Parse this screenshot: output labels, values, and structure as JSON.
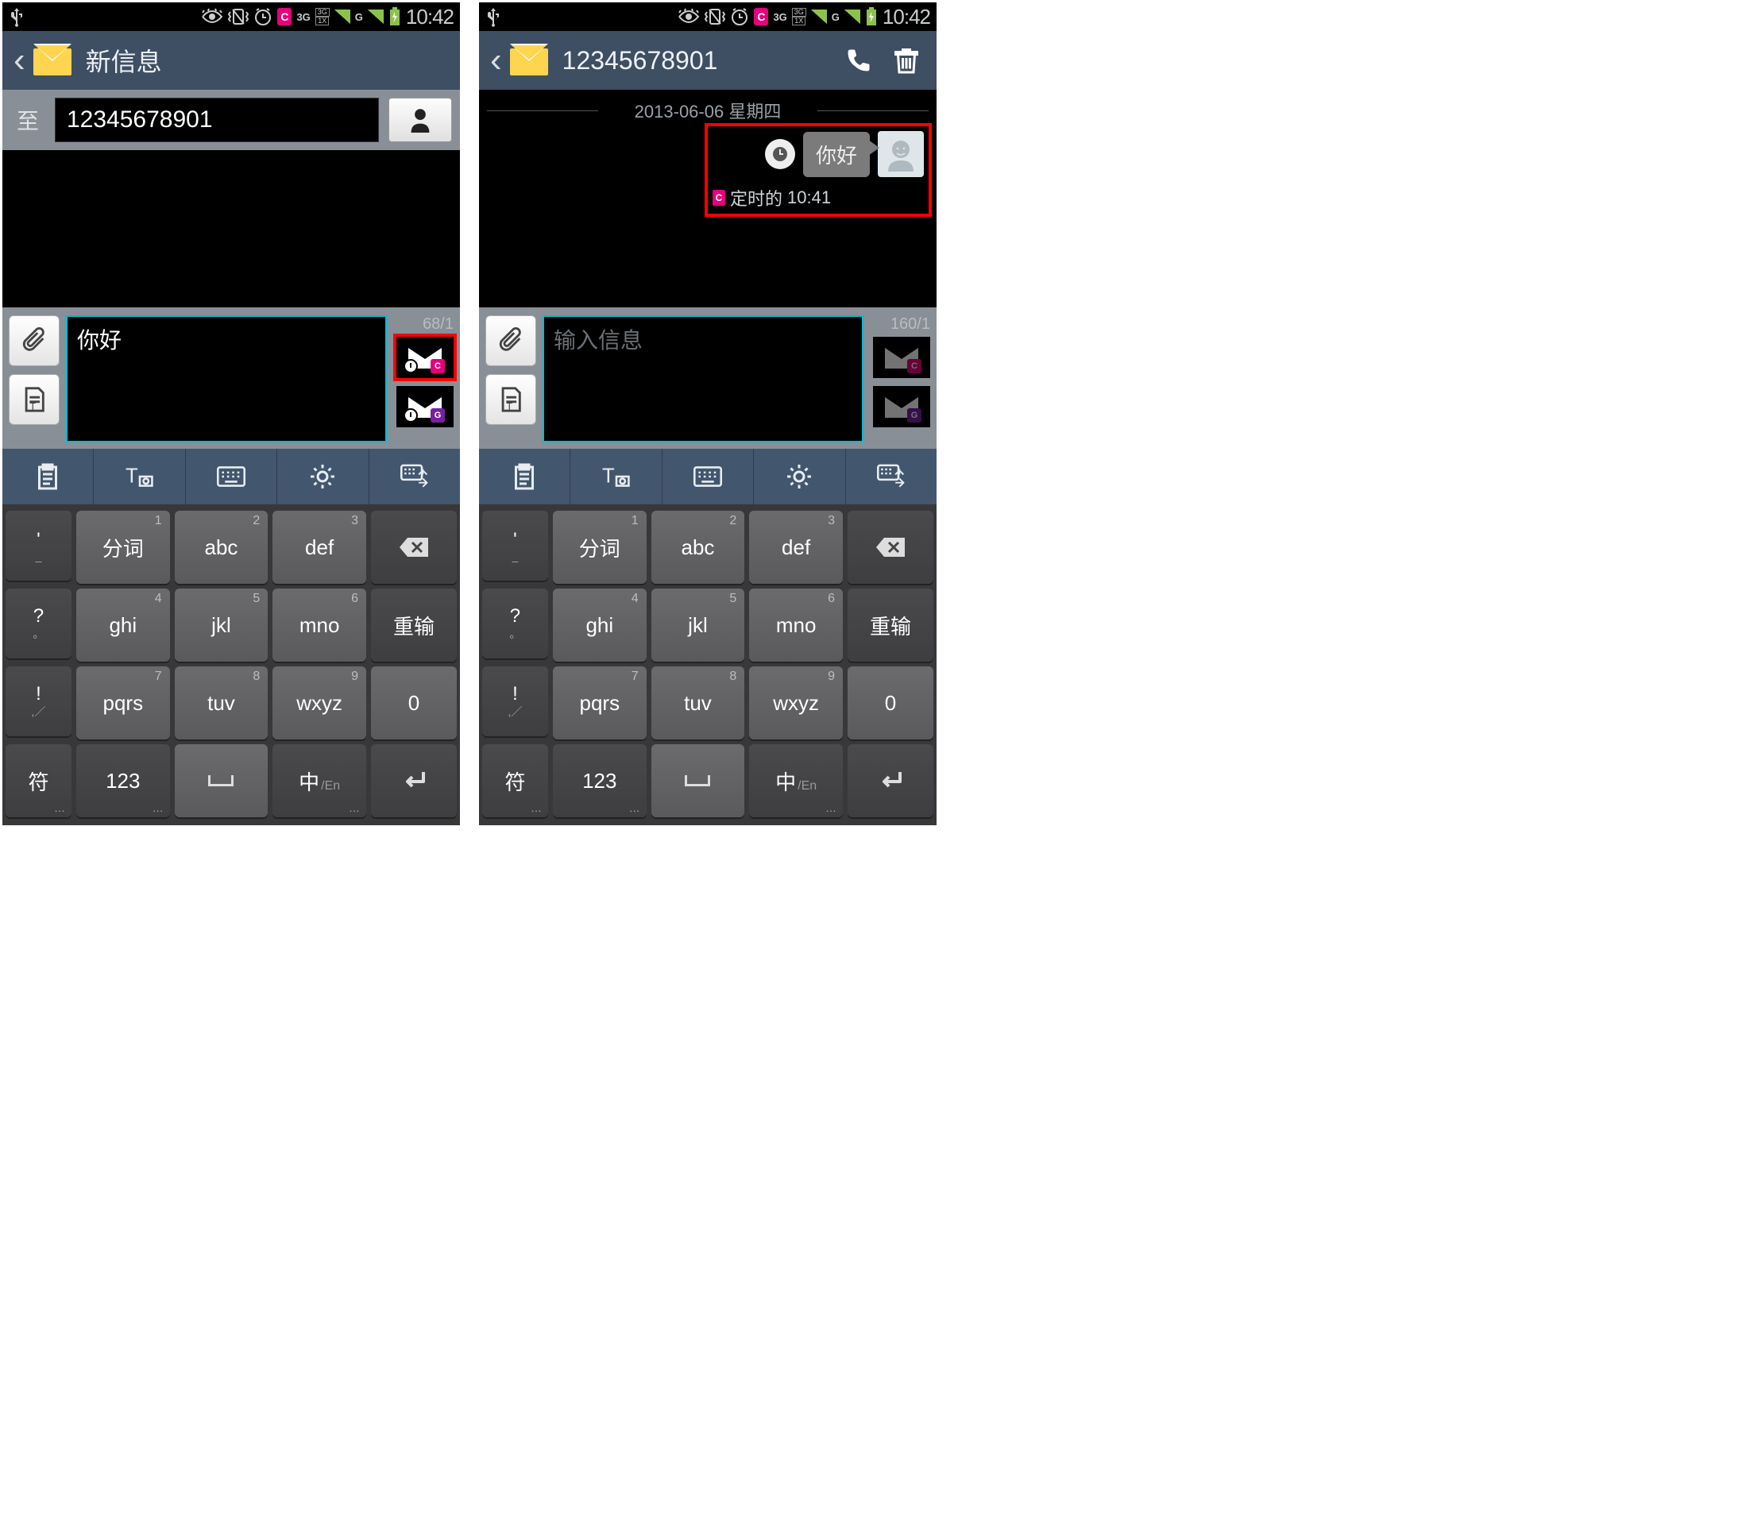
{
  "status": {
    "time": "10:42",
    "net1": "3G",
    "net2a": "3G",
    "net2b": "1X",
    "g": "G",
    "sim": "C"
  },
  "left": {
    "title": "新信息",
    "recipient_label": "至",
    "recipient_value": "12345678901",
    "compose_value": "你好",
    "counter": "68/1"
  },
  "right": {
    "title": "12345678901",
    "date_sep": "2013-06-06 星期四",
    "bubble_text": "你好",
    "scheduled_label": "定时的",
    "scheduled_time": "10:41",
    "compose_placeholder": "输入信息",
    "counter": "160/1"
  },
  "send_tags": {
    "c": "C",
    "g": "G"
  },
  "keyboard": {
    "punct": [
      "'",
      "?",
      "!"
    ],
    "punct_sub": [
      "_",
      "。",
      ",／"
    ],
    "r1": [
      {
        "main": "分词",
        "num": "1"
      },
      {
        "main": "abc",
        "num": "2"
      },
      {
        "main": "def",
        "num": "3"
      }
    ],
    "r2": [
      {
        "main": "ghi",
        "num": "4"
      },
      {
        "main": "jkl",
        "num": "5"
      },
      {
        "main": "mno",
        "num": "6"
      }
    ],
    "r3": [
      {
        "main": "pqrs",
        "num": "7"
      },
      {
        "main": "tuv",
        "num": "8"
      },
      {
        "main": "wxyz",
        "num": "9"
      }
    ],
    "retype": "重输",
    "zero": "0",
    "sym": "符",
    "num_mode": "123",
    "cn": "中",
    "en": "/En"
  }
}
